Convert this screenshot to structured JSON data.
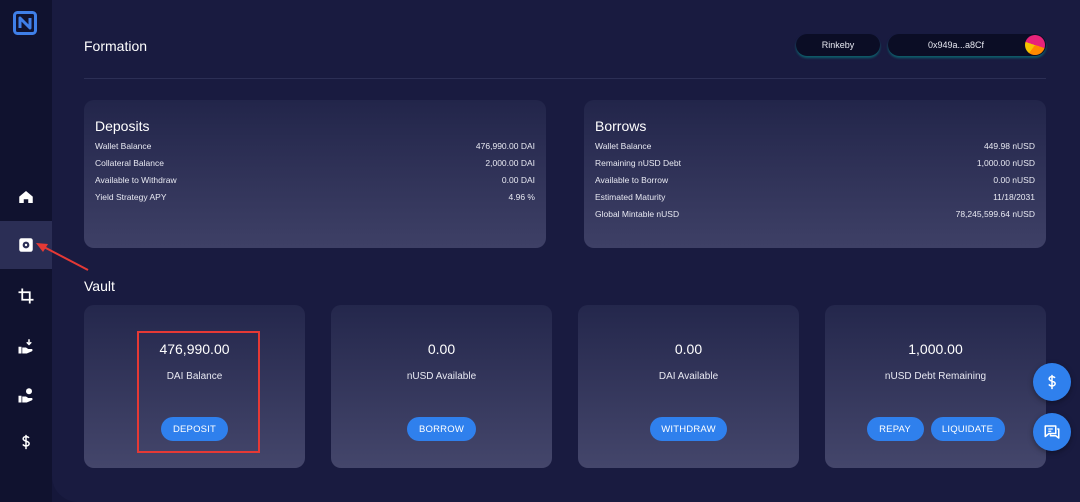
{
  "header": {
    "title": "Formation",
    "network": "Rinkeby",
    "address": "0x949a...a8Cf"
  },
  "deposits": {
    "title": "Deposits",
    "rows": [
      {
        "label": "Wallet Balance",
        "value": "476,990.00 DAI"
      },
      {
        "label": "Collateral Balance",
        "value": "2,000.00 DAI"
      },
      {
        "label": "Available to Withdraw",
        "value": "0.00 DAI"
      },
      {
        "label": "Yield Strategy APY",
        "value": "4.96 %"
      }
    ]
  },
  "borrows": {
    "title": "Borrows",
    "rows": [
      {
        "label": "Wallet Balance",
        "value": "449.98 nUSD"
      },
      {
        "label": "Remaining nUSD Debt",
        "value": "1,000.00 nUSD"
      },
      {
        "label": "Available to Borrow",
        "value": "0.00 nUSD"
      },
      {
        "label": "Estimated Maturity",
        "value": "11/18/2031"
      },
      {
        "label": "Global Mintable nUSD",
        "value": "78,245,599.64 nUSD"
      }
    ]
  },
  "vault": {
    "title": "Vault",
    "cards": [
      {
        "value": "476,990.00",
        "label": "DAI Balance",
        "buttons": [
          "DEPOSIT"
        ]
      },
      {
        "value": "0.00",
        "label": "nUSD Available",
        "buttons": [
          "BORROW"
        ]
      },
      {
        "value": "0.00",
        "label": "DAI Available",
        "buttons": [
          "WITHDRAW"
        ]
      },
      {
        "value": "1,000.00",
        "label": "nUSD Debt Remaining",
        "buttons": [
          "REPAY",
          "LIQUIDATE"
        ]
      }
    ]
  },
  "sidebar": {
    "items": [
      "home-icon",
      "vault-icon",
      "crop-icon",
      "hand-deposit-icon",
      "hand-coin-icon",
      "dollar-icon"
    ],
    "active_index": 1
  },
  "colors": {
    "background": "#15173a",
    "accent": "#2f80ed",
    "annotation": "#e53935"
  }
}
